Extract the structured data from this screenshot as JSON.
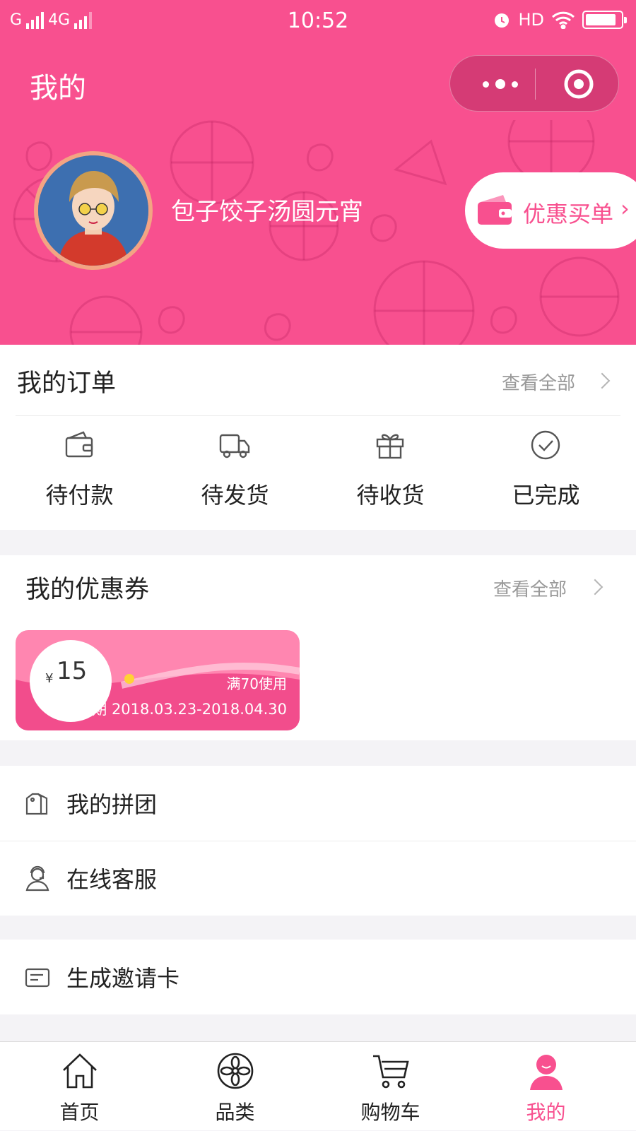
{
  "status_bar": {
    "network_left": "G",
    "network_right": "4G",
    "time": "10:52",
    "hd": "HD"
  },
  "header": {
    "title": "我的",
    "username": "包子饺子汤圆元宵",
    "deal_button": "优惠买单"
  },
  "orders": {
    "title": "我的订单",
    "see_all": "查看全部",
    "items": [
      {
        "label": "待付款",
        "icon": "wallet-icon"
      },
      {
        "label": "待发货",
        "icon": "truck-icon"
      },
      {
        "label": "待收货",
        "icon": "gift-icon"
      },
      {
        "label": "已完成",
        "icon": "check-circle-icon"
      }
    ]
  },
  "coupons": {
    "title": "我的优惠券",
    "see_all": "查看全部",
    "coupon": {
      "currency": "¥",
      "amount": "15",
      "condition": "满70使用",
      "validity": "有效期 2018.03.23-2018.04.30"
    }
  },
  "menu": {
    "group_buy": "我的拼团",
    "customer_service": "在线客服",
    "invite_card": "生成邀请卡"
  },
  "tabbar": {
    "items": [
      {
        "label": "首页",
        "icon": "home-icon"
      },
      {
        "label": "品类",
        "icon": "category-icon"
      },
      {
        "label": "购物车",
        "icon": "cart-icon"
      },
      {
        "label": "我的",
        "icon": "user-icon"
      }
    ],
    "active_index": 3
  },
  "colors": {
    "brand_pink": "#f8508f",
    "coupon_pink": "#ff86b0",
    "background": "#f4f3f6"
  }
}
